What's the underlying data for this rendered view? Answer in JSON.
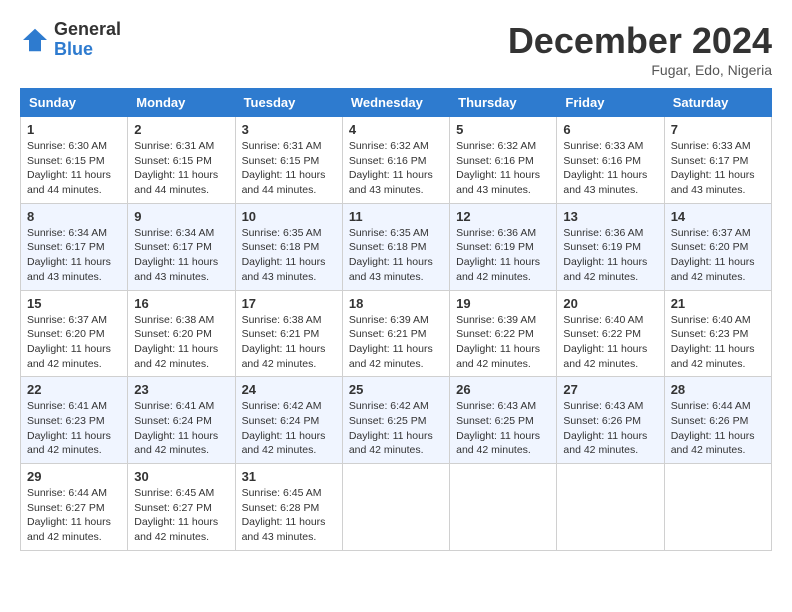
{
  "logo": {
    "general": "General",
    "blue": "Blue"
  },
  "title": "December 2024",
  "location": "Fugar, Edo, Nigeria",
  "days_header": [
    "Sunday",
    "Monday",
    "Tuesday",
    "Wednesday",
    "Thursday",
    "Friday",
    "Saturday"
  ],
  "weeks": [
    [
      {
        "day": "1",
        "sunrise": "6:30 AM",
        "sunset": "6:15 PM",
        "daylight": "11 hours and 44 minutes."
      },
      {
        "day": "2",
        "sunrise": "6:31 AM",
        "sunset": "6:15 PM",
        "daylight": "11 hours and 44 minutes."
      },
      {
        "day": "3",
        "sunrise": "6:31 AM",
        "sunset": "6:15 PM",
        "daylight": "11 hours and 44 minutes."
      },
      {
        "day": "4",
        "sunrise": "6:32 AM",
        "sunset": "6:16 PM",
        "daylight": "11 hours and 43 minutes."
      },
      {
        "day": "5",
        "sunrise": "6:32 AM",
        "sunset": "6:16 PM",
        "daylight": "11 hours and 43 minutes."
      },
      {
        "day": "6",
        "sunrise": "6:33 AM",
        "sunset": "6:16 PM",
        "daylight": "11 hours and 43 minutes."
      },
      {
        "day": "7",
        "sunrise": "6:33 AM",
        "sunset": "6:17 PM",
        "daylight": "11 hours and 43 minutes."
      }
    ],
    [
      {
        "day": "8",
        "sunrise": "6:34 AM",
        "sunset": "6:17 PM",
        "daylight": "11 hours and 43 minutes."
      },
      {
        "day": "9",
        "sunrise": "6:34 AM",
        "sunset": "6:17 PM",
        "daylight": "11 hours and 43 minutes."
      },
      {
        "day": "10",
        "sunrise": "6:35 AM",
        "sunset": "6:18 PM",
        "daylight": "11 hours and 43 minutes."
      },
      {
        "day": "11",
        "sunrise": "6:35 AM",
        "sunset": "6:18 PM",
        "daylight": "11 hours and 43 minutes."
      },
      {
        "day": "12",
        "sunrise": "6:36 AM",
        "sunset": "6:19 PM",
        "daylight": "11 hours and 42 minutes."
      },
      {
        "day": "13",
        "sunrise": "6:36 AM",
        "sunset": "6:19 PM",
        "daylight": "11 hours and 42 minutes."
      },
      {
        "day": "14",
        "sunrise": "6:37 AM",
        "sunset": "6:20 PM",
        "daylight": "11 hours and 42 minutes."
      }
    ],
    [
      {
        "day": "15",
        "sunrise": "6:37 AM",
        "sunset": "6:20 PM",
        "daylight": "11 hours and 42 minutes."
      },
      {
        "day": "16",
        "sunrise": "6:38 AM",
        "sunset": "6:20 PM",
        "daylight": "11 hours and 42 minutes."
      },
      {
        "day": "17",
        "sunrise": "6:38 AM",
        "sunset": "6:21 PM",
        "daylight": "11 hours and 42 minutes."
      },
      {
        "day": "18",
        "sunrise": "6:39 AM",
        "sunset": "6:21 PM",
        "daylight": "11 hours and 42 minutes."
      },
      {
        "day": "19",
        "sunrise": "6:39 AM",
        "sunset": "6:22 PM",
        "daylight": "11 hours and 42 minutes."
      },
      {
        "day": "20",
        "sunrise": "6:40 AM",
        "sunset": "6:22 PM",
        "daylight": "11 hours and 42 minutes."
      },
      {
        "day": "21",
        "sunrise": "6:40 AM",
        "sunset": "6:23 PM",
        "daylight": "11 hours and 42 minutes."
      }
    ],
    [
      {
        "day": "22",
        "sunrise": "6:41 AM",
        "sunset": "6:23 PM",
        "daylight": "11 hours and 42 minutes."
      },
      {
        "day": "23",
        "sunrise": "6:41 AM",
        "sunset": "6:24 PM",
        "daylight": "11 hours and 42 minutes."
      },
      {
        "day": "24",
        "sunrise": "6:42 AM",
        "sunset": "6:24 PM",
        "daylight": "11 hours and 42 minutes."
      },
      {
        "day": "25",
        "sunrise": "6:42 AM",
        "sunset": "6:25 PM",
        "daylight": "11 hours and 42 minutes."
      },
      {
        "day": "26",
        "sunrise": "6:43 AM",
        "sunset": "6:25 PM",
        "daylight": "11 hours and 42 minutes."
      },
      {
        "day": "27",
        "sunrise": "6:43 AM",
        "sunset": "6:26 PM",
        "daylight": "11 hours and 42 minutes."
      },
      {
        "day": "28",
        "sunrise": "6:44 AM",
        "sunset": "6:26 PM",
        "daylight": "11 hours and 42 minutes."
      }
    ],
    [
      {
        "day": "29",
        "sunrise": "6:44 AM",
        "sunset": "6:27 PM",
        "daylight": "11 hours and 42 minutes."
      },
      {
        "day": "30",
        "sunrise": "6:45 AM",
        "sunset": "6:27 PM",
        "daylight": "11 hours and 42 minutes."
      },
      {
        "day": "31",
        "sunrise": "6:45 AM",
        "sunset": "6:28 PM",
        "daylight": "11 hours and 43 minutes."
      },
      null,
      null,
      null,
      null
    ]
  ]
}
